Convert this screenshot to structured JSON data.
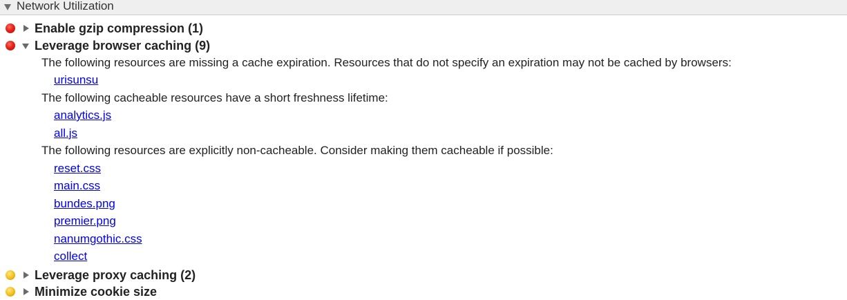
{
  "section": {
    "title": "Network Utilization"
  },
  "rules": {
    "gzip": {
      "label": "Enable gzip compression (1)",
      "severity": "red"
    },
    "caching": {
      "label": "Leverage browser caching (9)",
      "severity": "red",
      "groups": [
        {
          "text": "The following resources are missing a cache expiration. Resources that do not specify an expiration may not be cached by browsers:",
          "links": [
            "urisunsu"
          ]
        },
        {
          "text": "The following cacheable resources have a short freshness lifetime:",
          "links": [
            "analytics.js",
            "all.js"
          ]
        },
        {
          "text": "The following resources are explicitly non-cacheable. Consider making them cacheable if possible:",
          "links": [
            "reset.css",
            "main.css",
            "bundes.png",
            "premier.png",
            "nanumgothic.css",
            "collect"
          ]
        }
      ]
    },
    "proxy": {
      "label": "Leverage proxy caching (2)",
      "severity": "yellow"
    },
    "cookie": {
      "label": "Minimize cookie size",
      "severity": "yellow"
    }
  },
  "colors": {
    "link": "#0000ee",
    "severity_red": "#e3231a",
    "severity_yellow": "#f3c21f",
    "header_bg": "#efefef"
  }
}
